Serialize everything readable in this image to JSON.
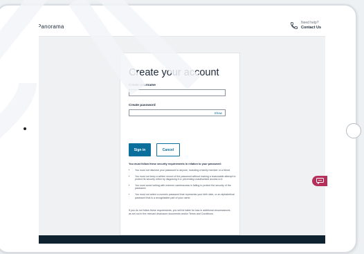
{
  "app": {
    "brand": "Panorama"
  },
  "help": {
    "need_help": "Need help?",
    "contact": "Contact Us",
    "icon": "phone-icon"
  },
  "form": {
    "title": "Create your account",
    "username_label": "Create username",
    "username_value": "",
    "password_label": "Create password",
    "password_value": "",
    "show_label": "Show",
    "signin_label": "Sign in",
    "cancel_label": "Cancel"
  },
  "requirements": {
    "heading": "You must follow these security requirements in relation to your password:",
    "items": [
      "You must not disclose your password to anyone, including a family member or a friend.",
      "You must not keep a written record of the password without making a reasonable attempt to protect its security either by disguising it or preventing unauthorised access to it.",
      "You must avoid writing with extreme carelessness in failing to protect the security of the password.",
      "You must not select a numeric password that represents your birth date, or an alphabetical password that is a recognisable part of your name."
    ],
    "footer": "If you do not follow these requirements, you will be liable for loss in additional circumstances as set out in the relevant disclosure documents and/or Terms and Conditions."
  },
  "chat": {
    "icon": "chat-icon"
  },
  "colors": {
    "accent": "#0b6f9c",
    "chat": "#b5305b",
    "footer": "#0f2230"
  }
}
